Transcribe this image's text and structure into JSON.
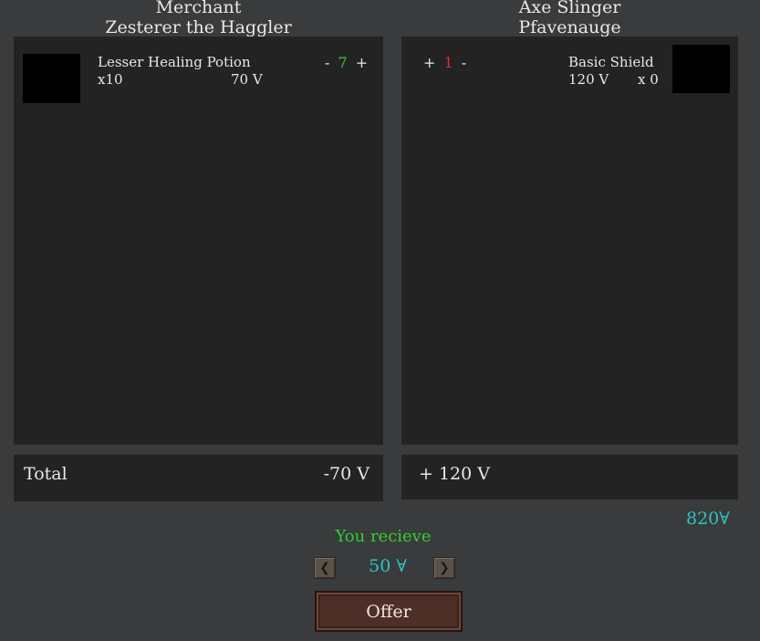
{
  "merchant": {
    "role": "Merchant",
    "name": "Zesterer the Haggler",
    "items": [
      {
        "name": "Lesser Healing Potion",
        "stock": "x10",
        "price": "70 V",
        "minus": "-",
        "qty": "7",
        "plus": "+"
      }
    ],
    "total_label": "Total",
    "total_value": "-70 V"
  },
  "player": {
    "role": "Axe Slinger",
    "name": "Pfavenauge",
    "items": [
      {
        "name": "Basic Shield",
        "price": "120 V",
        "stock": "x 0",
        "plus": "+",
        "qty": "1",
        "minus": "-"
      }
    ],
    "total_value": "+ 120 V",
    "gold": "820∀"
  },
  "trade": {
    "receive_label": "You recieve",
    "amount": "50 ∀",
    "prev_arrow": "❮",
    "next_arrow": "❯",
    "offer_label": "Offer"
  },
  "colors": {
    "positive": "#2fd12f",
    "negative": "#e02b2b",
    "currency": "#2ec4c4",
    "button": "#4e2f28"
  }
}
